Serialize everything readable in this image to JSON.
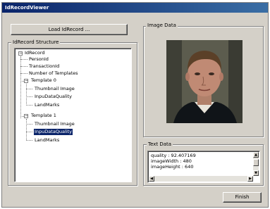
{
  "window": {
    "title": "IdRecordViewer"
  },
  "toolbar": {
    "load_label": "Load IdRecord ..."
  },
  "structure": {
    "label": "IdRecord Structure",
    "tree": {
      "root": "IdRecord",
      "person_id": "PersonId",
      "transaction_id": "TransactionId",
      "num_templates": "Number of Templates",
      "template0": {
        "label": "Template 0",
        "children": [
          "Thumbnail Image",
          "InpuDataQuality",
          "LandMarks"
        ]
      },
      "template1": {
        "label": "Template 1",
        "children": [
          "Thumbnail Image",
          "InpuDataQuality",
          "LandMarks"
        ]
      }
    }
  },
  "image_panel": {
    "label": "Image Data"
  },
  "text_panel": {
    "label": "Text Data",
    "lines": [
      "quality : 92.407169",
      "imageWidth : 480",
      "imageHeight : 640"
    ]
  },
  "footer": {
    "finish_label": "Finish"
  },
  "icons": {
    "expanded": "minus-box-icon",
    "scroll_up": "triangle-up-icon",
    "scroll_down": "triangle-down-icon",
    "scroll_left": "triangle-left-icon",
    "scroll_right": "triangle-right-icon"
  },
  "colors": {
    "titlebar": "#0a246a",
    "face": "#d4d0c8",
    "selection": "#0a246a"
  }
}
